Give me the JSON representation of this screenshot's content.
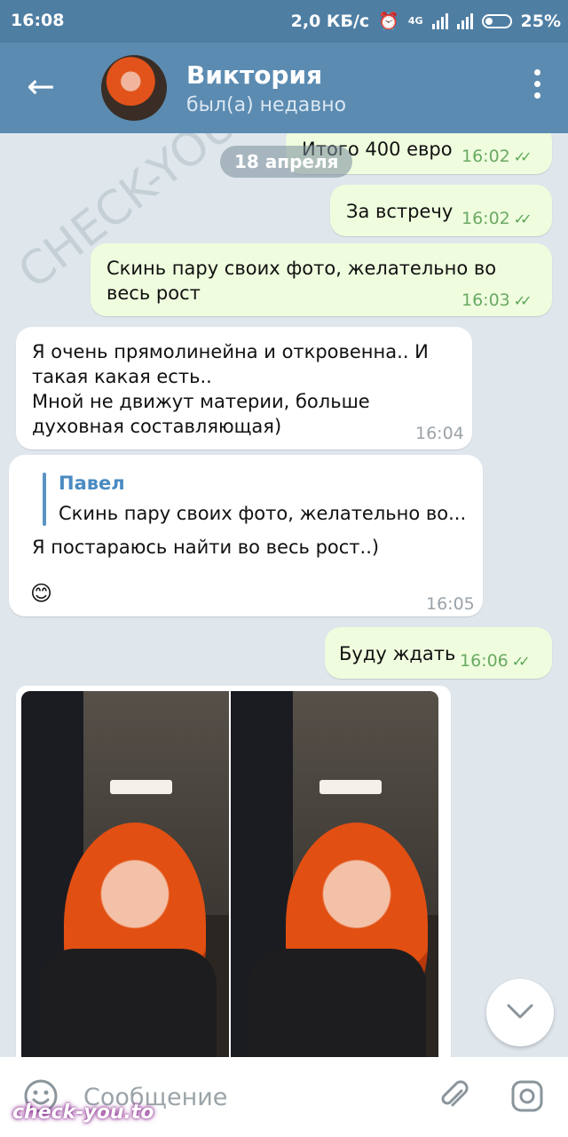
{
  "status_bar": {
    "time": "16:08",
    "speed": "2,0 КБ/с",
    "network": "4G",
    "battery": "25%"
  },
  "header": {
    "name": "Виктория",
    "status": "был(а) недавно"
  },
  "date_pill": "18 апреля",
  "messages": [
    {
      "text": "Итого 400 евро",
      "time": "16:02"
    },
    {
      "text": "За встречу",
      "time": "16:02"
    },
    {
      "text": "Скинь пару своих фото, желательно во весь рост",
      "time": "16:03"
    },
    {
      "text": "Я очень прямолинейна и откровенна.. И такая какая есть..\nМной не движут материи, больше духовная составляющая)",
      "time": "16:04"
    },
    {
      "reply_name": "Павел",
      "reply_text": "Скинь пару своих фото, желательно во...",
      "text": "Я постараюсь найти во весь рост..)",
      "emoji": "😊",
      "time": "16:05"
    },
    {
      "text": "Буду ждать",
      "time": "16:06"
    }
  ],
  "composer": {
    "placeholder": "Сообщение"
  },
  "watermark": {
    "diagonal": "CHECK-YOU-ME",
    "logo": "check-you.to"
  },
  "colors": {
    "header": "#5b8bb1",
    "outgoing_bubble": "#effdde",
    "incoming_bubble": "#ffffff",
    "checks": "#5ba656"
  }
}
